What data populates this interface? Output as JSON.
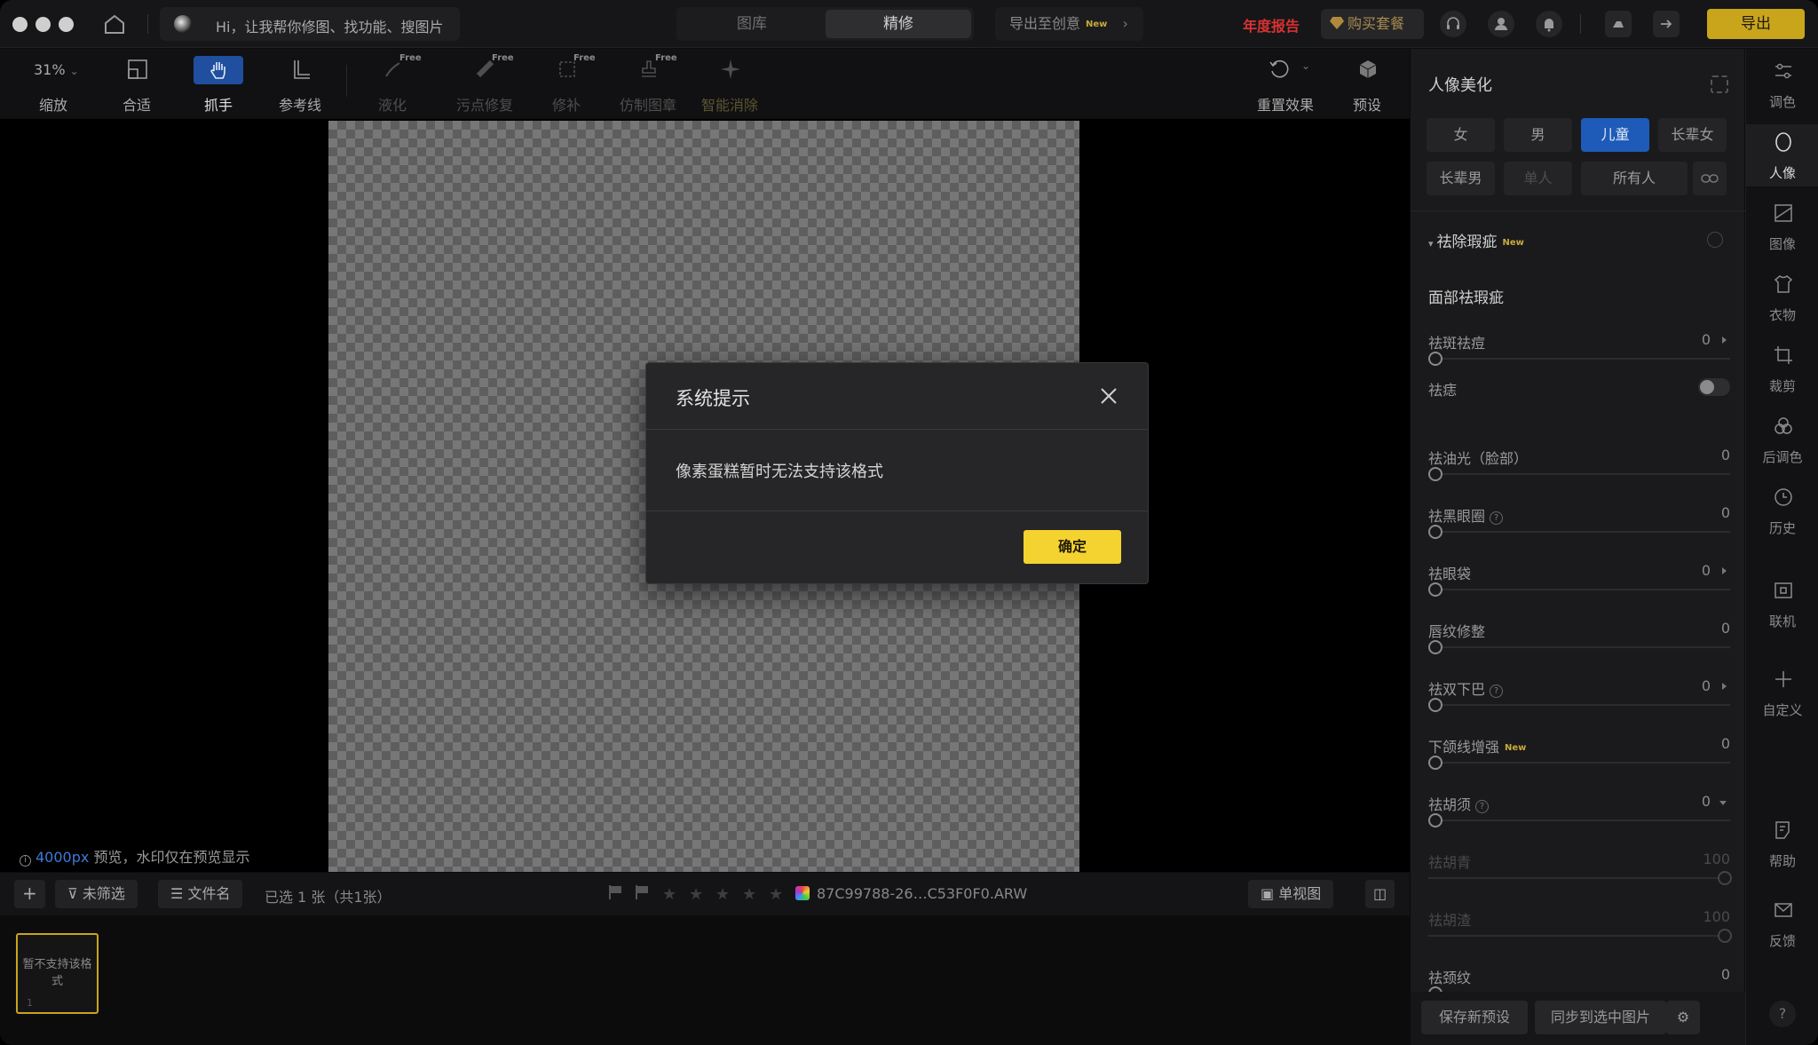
{
  "topbar": {
    "ai_prompt": "Hi，让我帮你修图、找功能、搜图片",
    "tabs": [
      {
        "label": "图库"
      },
      {
        "label": "精修"
      }
    ],
    "active_tab": "精修",
    "export_creative": "导出至创意",
    "new_badge": "New",
    "annual_report": "年度报告",
    "buy_label": "购买套餐",
    "export_label": "导出"
  },
  "toolbar": {
    "zoom_value": "31%",
    "free_badge": "Free",
    "tools": [
      {
        "label": "缩放"
      },
      {
        "label": "合适"
      },
      {
        "label": "抓手"
      },
      {
        "label": "参考线"
      },
      {
        "label": "液化"
      },
      {
        "label": "污点修复"
      },
      {
        "label": "修补"
      },
      {
        "label": "仿制图章"
      },
      {
        "label": "智能消除"
      },
      {
        "label": "重置效果"
      },
      {
        "label": "预设"
      }
    ]
  },
  "canvas": {
    "preview_px": "4000px",
    "preview_note": "预览，水印仅在预览显示"
  },
  "filmbar": {
    "filter_label": "未筛选",
    "sort_label": "文件名",
    "selection_text": "已选 1 张（共1张）",
    "filename": "87C99788-26…C53F0F0.ARW",
    "single_view": "单视图",
    "stars": [
      "★",
      "★",
      "★",
      "★",
      "★"
    ]
  },
  "film": {
    "thumb_text": "暂不支持该格式",
    "thumb_index": "1"
  },
  "panel": {
    "title": "人像美化",
    "chips": [
      {
        "label": "女"
      },
      {
        "label": "男"
      },
      {
        "label": "儿童"
      },
      {
        "label": "长辈女"
      },
      {
        "label": "长辈男"
      },
      {
        "label": "单人"
      },
      {
        "label": "所有人"
      }
    ],
    "active_chip": "儿童",
    "section": "祛除瑕疵",
    "section_badge": "New",
    "subsection": "面部祛瑕疵",
    "sliders": [
      {
        "label": "祛斑祛痘",
        "value": "0"
      },
      {
        "label": "祛痣",
        "value": ""
      },
      {
        "label": "祛油光（脸部）",
        "value": "0"
      },
      {
        "label": "祛黑眼圈",
        "value": "0"
      },
      {
        "label": "祛眼袋",
        "value": "0"
      },
      {
        "label": "唇纹修整",
        "value": "0"
      },
      {
        "label": "祛双下巴",
        "value": "0"
      },
      {
        "label": "下颌线增强",
        "value": "0",
        "badge": "New"
      },
      {
        "label": "祛胡须",
        "value": "0"
      },
      {
        "label": "祛胡青",
        "value": "100"
      },
      {
        "label": "祛胡渣",
        "value": "100"
      },
      {
        "label": "祛颈纹",
        "value": "0"
      }
    ],
    "save_preset": "保存新预设",
    "sync_selected": "同步到选中图片"
  },
  "rail": {
    "items": [
      {
        "label": "调色"
      },
      {
        "label": "人像"
      },
      {
        "label": "图像"
      },
      {
        "label": "衣物"
      },
      {
        "label": "裁剪"
      },
      {
        "label": "后调色"
      },
      {
        "label": "历史"
      },
      {
        "label": "联机"
      },
      {
        "label": "自定义"
      },
      {
        "label": "帮助"
      },
      {
        "label": "反馈"
      }
    ],
    "help_glyph": "?"
  },
  "modal": {
    "title": "系统提示",
    "message": "像素蛋糕暂时无法支持该格式",
    "ok_label": "确定"
  },
  "colors": {
    "accent_blue": "#1e5bb8",
    "export_gold": "#c9a51b",
    "ok_yellow": "#f4d330",
    "annual_red": "#d83232"
  }
}
